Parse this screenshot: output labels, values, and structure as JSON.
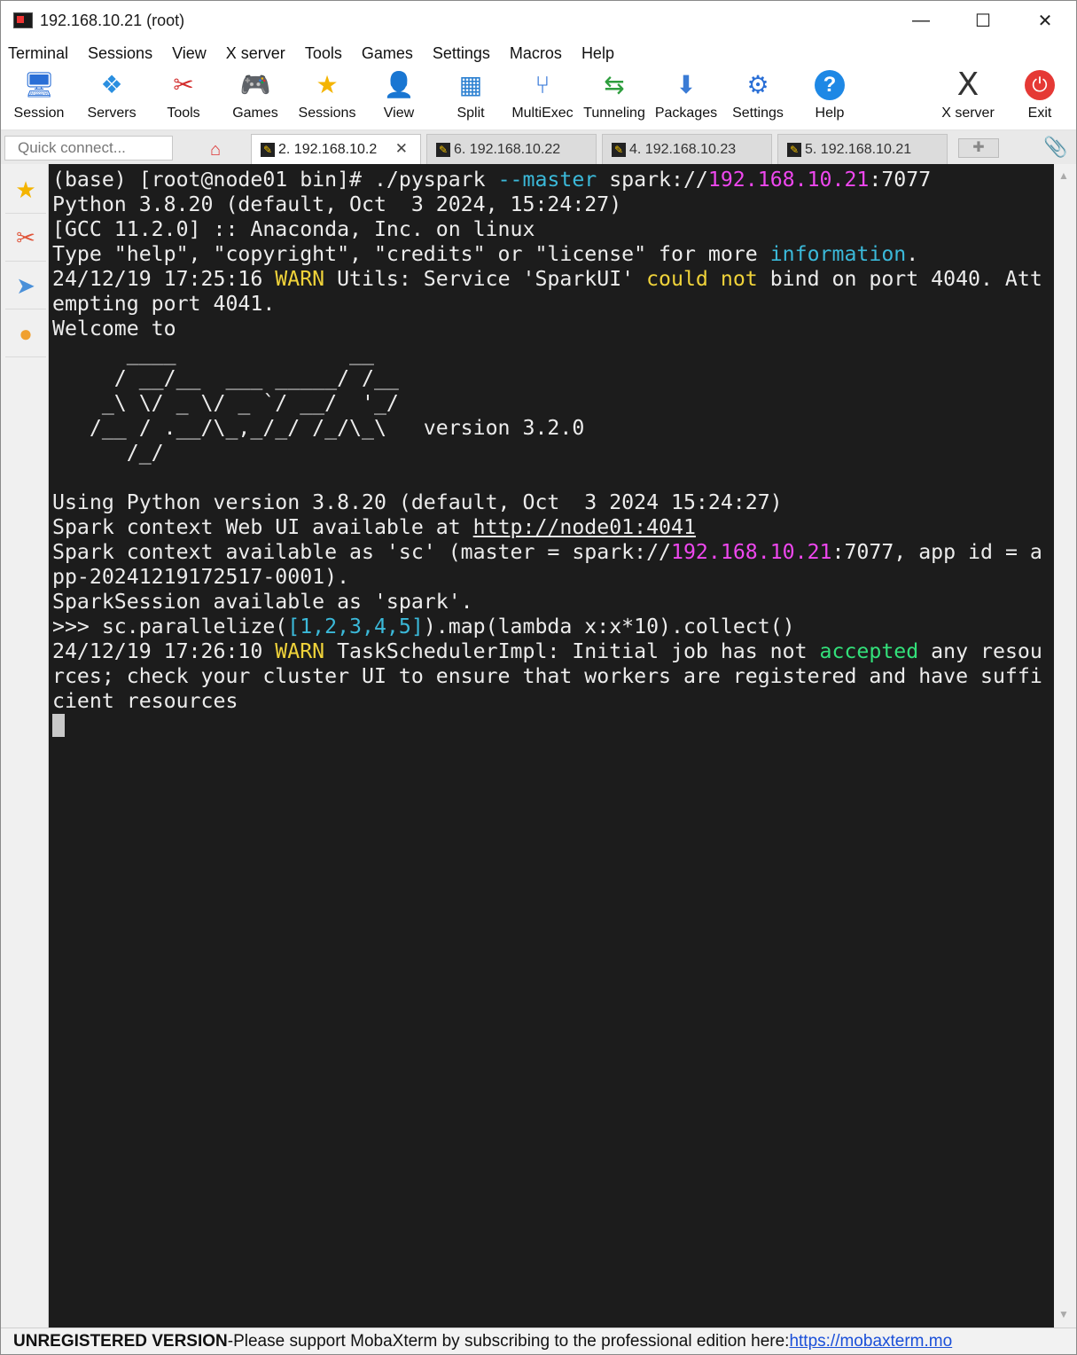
{
  "window": {
    "title": "192.168.10.21 (root)",
    "controls": [
      "—",
      "☐",
      "✕"
    ]
  },
  "menu": [
    "Terminal",
    "Sessions",
    "View",
    "X server",
    "Tools",
    "Games",
    "Settings",
    "Macros",
    "Help"
  ],
  "toolbar": [
    {
      "label": "Session",
      "icon": "monitor-icon",
      "glyph": "🖥",
      "color": "#2a6fd6"
    },
    {
      "label": "Servers",
      "icon": "servers-icon",
      "glyph": "❖",
      "color": "#2a8fe0"
    },
    {
      "label": "Tools",
      "icon": "tools-icon",
      "glyph": "✂",
      "color": "#d32f2f"
    },
    {
      "label": "Games",
      "icon": "gamepad-icon",
      "glyph": "🎮",
      "color": "#555555"
    },
    {
      "label": "Sessions",
      "icon": "star-icon",
      "glyph": "★",
      "color": "#f4b400"
    },
    {
      "label": "View",
      "icon": "view-icon",
      "glyph": "👤",
      "color": "#3a7bd5"
    },
    {
      "label": "Split",
      "icon": "split-icon",
      "glyph": "▦",
      "color": "#2a7fd0"
    },
    {
      "label": "MultiExec",
      "icon": "multiexec-icon",
      "glyph": "⑂",
      "color": "#2a6fd6"
    },
    {
      "label": "Tunneling",
      "icon": "tunneling-icon",
      "glyph": "⇆",
      "color": "#2e9e3e"
    },
    {
      "label": "Packages",
      "icon": "packages-icon",
      "glyph": "⬇",
      "color": "#3a7bd5"
    },
    {
      "label": "Settings",
      "icon": "settings-icon",
      "glyph": "⚙",
      "color": "#2a6fd6"
    },
    {
      "label": "Help",
      "icon": "help-icon",
      "glyph": "?",
      "color": "#1e88e5"
    },
    {
      "label": "X server",
      "icon": "xserver-icon",
      "glyph": "X",
      "color": "#333333"
    },
    {
      "label": "Exit",
      "icon": "power-icon",
      "glyph": "⏻",
      "color": "#e53935"
    }
  ],
  "quick_connect": {
    "placeholder": "Quick connect..."
  },
  "tabs": [
    {
      "label": "2. 192.168.10.2",
      "active": true
    },
    {
      "label": "6. 192.168.10.22",
      "active": false
    },
    {
      "label": "4. 192.168.10.23",
      "active": false
    },
    {
      "label": "5. 192.168.10.21",
      "active": false
    }
  ],
  "sidebar": [
    {
      "icon": "favorites-star-icon",
      "glyph": "★",
      "color": "#f4b400"
    },
    {
      "icon": "tools-icon",
      "glyph": "✂",
      "color": "#e0553a"
    },
    {
      "icon": "send-icon",
      "glyph": "➤",
      "color": "#4a90d9"
    },
    {
      "icon": "globe-icon",
      "glyph": "●",
      "color": "#f0a030"
    }
  ],
  "terminal": {
    "lines": [
      [
        {
          "t": "(base) [root@node01 bin]# ./pyspark "
        },
        {
          "t": "--master",
          "c": "c-cyan"
        },
        {
          "t": " spark://"
        },
        {
          "t": "192.168.10.21",
          "c": "c-mag"
        },
        {
          "t": ":7077"
        }
      ],
      [
        {
          "t": "Python 3.8.20 (default, Oct  3 2024, 15:24:27)"
        }
      ],
      [
        {
          "t": "[GCC 11.2.0] :: Anaconda, Inc. on linux"
        }
      ],
      [
        {
          "t": "Type \"help\", \"copyright\", \"credits\" or \"license\" for more "
        },
        {
          "t": "information",
          "c": "c-cyan"
        },
        {
          "t": "."
        }
      ],
      [
        {
          "t": "24/12/19 17:25:16 "
        },
        {
          "t": "WARN",
          "c": "c-yel"
        },
        {
          "t": " Utils: Service 'SparkUI' "
        },
        {
          "t": "could not",
          "c": "c-yel"
        },
        {
          "t": " bind on port 4040. Att"
        }
      ],
      [
        {
          "t": "empting port 4041."
        }
      ],
      [
        {
          "t": "Welcome to"
        }
      ],
      [
        {
          "t": "      ____              __"
        }
      ],
      [
        {
          "t": "     / __/__  ___ _____/ /__"
        }
      ],
      [
        {
          "t": "    _\\ \\/ _ \\/ _ `/ __/  '_/"
        }
      ],
      [
        {
          "t": "   /__ / .__/\\_,_/_/ /_/\\_\\   version 3.2.0"
        }
      ],
      [
        {
          "t": "      /_/"
        }
      ],
      [
        {
          "t": ""
        }
      ],
      [
        {
          "t": "Using Python version 3.8.20 (default, Oct  3 2024 15:24:27)"
        }
      ],
      [
        {
          "t": "Spark context Web UI available at "
        },
        {
          "t": "http://node01:4041",
          "c": "c-link"
        }
      ],
      [
        {
          "t": "Spark context available as 'sc' (master = spark://"
        },
        {
          "t": "192.168.10.21",
          "c": "c-mag"
        },
        {
          "t": ":7077, app id = a"
        }
      ],
      [
        {
          "t": "pp-20241219172517-0001)."
        }
      ],
      [
        {
          "t": "SparkSession available as 'spark'."
        }
      ],
      [
        {
          "t": ">>> sc.parallelize("
        },
        {
          "t": "[1,2,3,4,5]",
          "c": "c-cyan"
        },
        {
          "t": ").map(lambda x:x*10).collect()"
        }
      ],
      [
        {
          "t": "24/12/19 17:26:10 "
        },
        {
          "t": "WARN",
          "c": "c-yel"
        },
        {
          "t": " TaskSchedulerImpl: Initial job has not "
        },
        {
          "t": "accepted",
          "c": "c-grn"
        },
        {
          "t": " any resou"
        }
      ],
      [
        {
          "t": "rces; check your cluster UI to ensure that workers are registered and have suffi"
        }
      ],
      [
        {
          "t": "cient resources"
        }
      ]
    ]
  },
  "statusbar": {
    "unregistered": "UNREGISTERED VERSION",
    "separator": " -  ",
    "message": "Please support MobaXterm by subscribing to the professional edition here: ",
    "url": "https://mobaxterm.mo"
  }
}
